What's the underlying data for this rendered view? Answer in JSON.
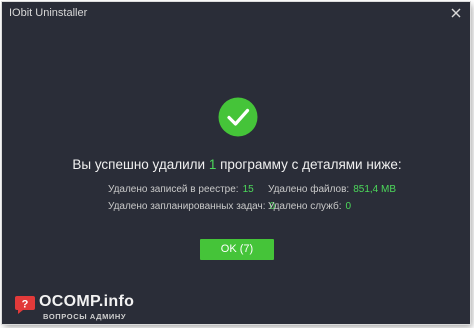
{
  "window": {
    "title": "IObit Uninstaller",
    "close_icon": "close-icon"
  },
  "result": {
    "success_icon": "checkmark-circle-icon",
    "headline_prefix": "Вы успешно удалили",
    "removed_count": "1",
    "headline_suffix": "программу с деталями ниже:"
  },
  "stats": {
    "registry_label": "Удалено записей в реестре:",
    "registry_value": "15",
    "files_label": "Удалено файлов:",
    "files_value": "851,4 MB",
    "tasks_label": "Удалено запланированных задач:",
    "tasks_value": "0",
    "services_label": "Удалено служб:",
    "services_value": "0"
  },
  "actions": {
    "ok_label": "OK (7)"
  },
  "watermark": {
    "brand": "OCOMP.info",
    "tagline": "ВОПРОСЫ АДМИНУ",
    "icon": "chat-question-icon"
  },
  "colors": {
    "background": "#2a2d38",
    "accent_green": "#4cd85a",
    "button_green": "#45c439",
    "text": "#f0f0f0"
  }
}
